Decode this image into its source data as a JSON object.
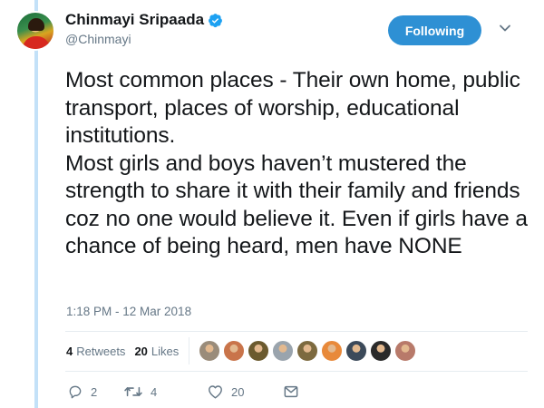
{
  "tweet": {
    "author": {
      "display_name": "Chinmayi Sripaada",
      "handle": "@Chinmayi",
      "verified": true
    },
    "follow_button_label": "Following",
    "text": "Most common places - Their own home, public transport, places of worship, educational institutions.\nMost girls and boys haven’t mustered the strength to share it with their family and friends coz no one would believe it. Even if girls have a chance of being heard, men have NONE",
    "timestamp": "1:18 PM - 12 Mar 2018",
    "stats": {
      "retweets_count": "4",
      "retweets_label": "Retweets",
      "likes_count": "20",
      "likes_label": "Likes"
    },
    "liker_avatar_colors": [
      "#9a8c7a",
      "#c9744a",
      "#6b5a2e",
      "#9aa4ad",
      "#7d6a3f",
      "#e8893a",
      "#3c4a5a",
      "#2a2a2a",
      "#b87a6a"
    ],
    "actions": {
      "reply_count": "2",
      "retweet_count": "4",
      "like_count": "20"
    }
  },
  "colors": {
    "accent": "#2e90d4",
    "thread_line": "#c3e1f8",
    "muted_text": "#657786",
    "verified": "#1da1f2"
  },
  "icons": [
    "verified-badge-icon",
    "chevron-down-icon",
    "reply-icon",
    "retweet-icon",
    "heart-icon",
    "message-icon"
  ]
}
